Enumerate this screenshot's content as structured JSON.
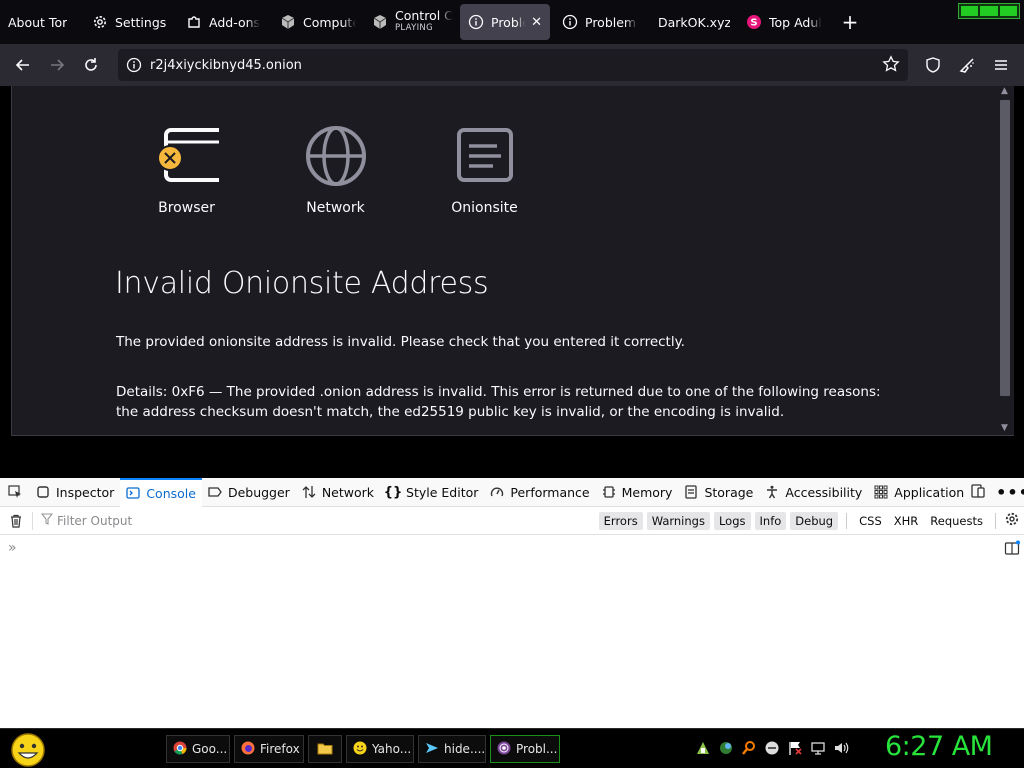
{
  "tabs": [
    {
      "label": "About Tor",
      "icon": "none"
    },
    {
      "label": "Settings",
      "icon": "gear-icon"
    },
    {
      "label": "Add-ons",
      "icon": "puzzle-icon"
    },
    {
      "label": "Compute",
      "icon": "cube-icon"
    },
    {
      "label": "Control C",
      "sub": "PLAYING",
      "icon": "cube-icon"
    },
    {
      "label": "Probler",
      "icon": "info-icon",
      "active": true
    },
    {
      "label": "Problem I",
      "icon": "info-icon"
    },
    {
      "label": "DarkOK.xyz",
      "icon": "none"
    },
    {
      "label": "Top Adult",
      "icon": "s-badge-icon"
    }
  ],
  "url": "r2j4xiyckibnyd45.onion",
  "steps": [
    {
      "label": "Browser",
      "icon": "browser-error-icon"
    },
    {
      "label": "Network",
      "icon": "globe-icon"
    },
    {
      "label": "Onionsite",
      "icon": "onionsite-icon"
    }
  ],
  "error": {
    "title": "Invalid Onionsite Address",
    "message": "The provided onionsite address is invalid. Please check that you entered it correctly.",
    "details": "Details: 0xF6 — The provided .onion address is invalid. This error is returned due to one of the following reasons: the address checksum doesn't match, the ed25519 public key is invalid, or the encoding is invalid."
  },
  "devtools": {
    "tabs": [
      "Inspector",
      "Console",
      "Debugger",
      "Network",
      "Style Editor",
      "Performance",
      "Memory",
      "Storage",
      "Accessibility",
      "Application"
    ],
    "active_tab": "Console",
    "filter_placeholder": "Filter Output",
    "levels": [
      "Errors",
      "Warnings",
      "Logs",
      "Info",
      "Debug"
    ],
    "extra_filters": [
      "CSS",
      "XHR",
      "Requests"
    ]
  },
  "taskbar": {
    "items": [
      {
        "label": "Goo...",
        "icon": "chrome-icon"
      },
      {
        "label": "Firefox",
        "icon": "firefox-icon"
      },
      {
        "label": "",
        "icon": "folder-icon"
      },
      {
        "label": "Yaho...",
        "icon": "yahoo-messenger-icon"
      },
      {
        "label": "hide....",
        "icon": "vpn-icon"
      },
      {
        "label": "Probl...",
        "icon": "tor-icon",
        "active": true
      }
    ],
    "clock": "6:27 AM"
  },
  "colors": {
    "accent": "#0a84ff",
    "clock": "#27e33a",
    "error_badge": "#f6b73c"
  }
}
